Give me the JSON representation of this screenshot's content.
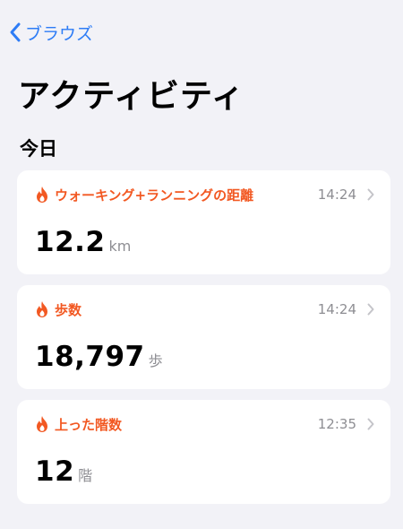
{
  "nav": {
    "back_label": "ブラウズ"
  },
  "page": {
    "title": "アクティビティ"
  },
  "section": {
    "title": "今日"
  },
  "cards": [
    {
      "icon": "flame-icon",
      "label": "ウォーキング+ランニングの距離",
      "time": "14:24",
      "value": "12.2",
      "unit": "km"
    },
    {
      "icon": "flame-icon",
      "label": "歩数",
      "time": "14:24",
      "value": "18,797",
      "unit": "歩"
    },
    {
      "icon": "flame-icon",
      "label": "上った階数",
      "time": "12:35",
      "value": "12",
      "unit": "階"
    }
  ],
  "colors": {
    "accent_blue": "#2d7cf6",
    "accent_orange": "#f25822",
    "background": "#f2f2f7",
    "card": "#ffffff",
    "secondary_text": "#8e8e93"
  }
}
